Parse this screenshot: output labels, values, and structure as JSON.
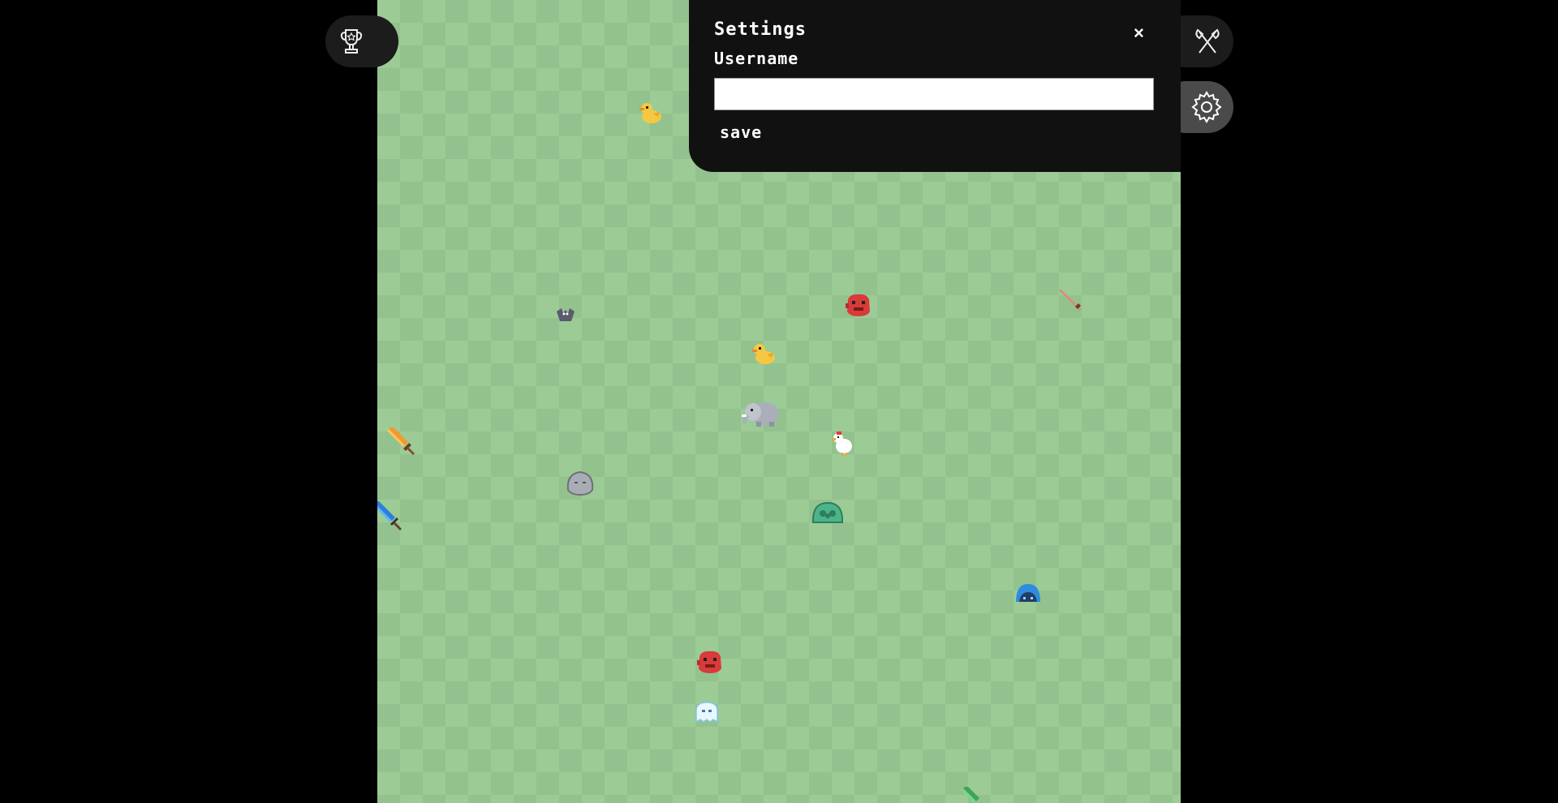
{
  "settings": {
    "title": "Settings",
    "close_label": "×",
    "username_label": "Username",
    "username_value": "",
    "save_label": "save"
  },
  "colors": {
    "background": "#000000",
    "field_light": "#9ccb96",
    "field_dark": "#93c28e",
    "panel": "#111111",
    "side_button": "#1c1c1c",
    "gear_button": "#4a4a4a"
  },
  "icons": [
    "trophy-icon",
    "crossed-axes-icon",
    "gear-icon"
  ],
  "entities": [
    "duck",
    "duck",
    "bat",
    "red-blob",
    "red-blob",
    "elephant",
    "chicken",
    "rock-creature",
    "green-slime",
    "blue-slime",
    "ghost",
    "orange-sword",
    "blue-sword",
    "wooden-sword",
    "green-sword"
  ]
}
